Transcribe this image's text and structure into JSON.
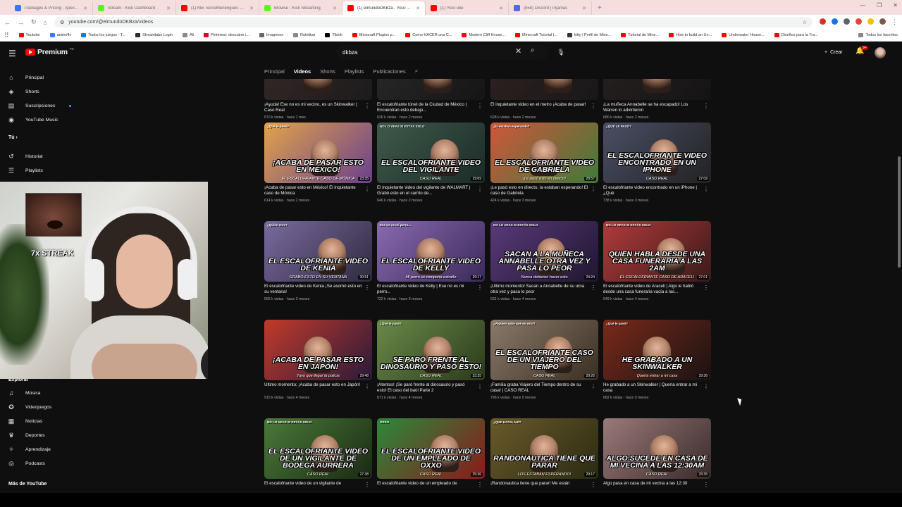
{
  "browser": {
    "tabs": [
      {
        "label": "Packages & Pricing - Apex Hosting",
        "color": "#3a78ff",
        "active": false
      },
      {
        "label": "Stream - Kick Dashboard",
        "color": "#53fc18",
        "active": false
      },
      {
        "label": "(1) Mix TecnoMenengues Clips",
        "color": "#ff0000",
        "active": false
      },
      {
        "label": "Browse - Kick Streaming",
        "color": "#53fc18",
        "active": false
      },
      {
        "label": "(1) elmundoDKBza - YouTube",
        "color": "#ff0000",
        "active": true
      },
      {
        "label": "(1) YouTube",
        "color": "#ff0000",
        "active": false
      },
      {
        "label": "(858) Discord | Pijamas",
        "color": "#5865f2",
        "active": false
      }
    ],
    "url": "youtube.com/@elmundoDKBza/videos",
    "bookmarks": [
      "Youtube",
      "animeflv",
      "Todos los juegos - T...",
      "Streamlabs Login",
      "Ali",
      "Pinterest: descubre i...",
      "Imagenes",
      "Ruletitas",
      "Tiktok",
      "Minecraft Plugins p...",
      "Como HACER una C...",
      "Modern Cliff House...",
      "Minecraft Tutorial |...",
      "kitty | Perfil de Mine...",
      "Tutorial de Mine...",
      "How to build an Un...",
      "Underwater House...",
      "Diseños para la Tra..."
    ],
    "bookmarks_right": "Todos los favoritos"
  },
  "youtube": {
    "logo": "Premium",
    "logo_cc": "PE",
    "search_value": "dkbza",
    "create_label": "Crear",
    "notif_count": "9+"
  },
  "sidebar": {
    "items_top": [
      {
        "label": "Principal",
        "icon": "home-icon",
        "glyph": "⌂"
      },
      {
        "label": "Shorts",
        "icon": "shorts-icon",
        "glyph": "◈"
      },
      {
        "label": "Suscripciones",
        "icon": "subscriptions-icon",
        "glyph": "▤"
      },
      {
        "label": "YouTube Music",
        "icon": "music-icon",
        "glyph": "◉"
      }
    ],
    "you_label": "Tú ›",
    "items_you": [
      {
        "label": "Historial",
        "icon": "history-icon",
        "glyph": "↺"
      },
      {
        "label": "Playlists",
        "icon": "playlists-icon",
        "glyph": "☰"
      },
      {
        "label": "Tus videos",
        "icon": "your-videos-icon",
        "glyph": "▶"
      }
    ],
    "explore_label": "Explorar",
    "items_explore": [
      {
        "label": "Música",
        "icon": "music-note-icon",
        "glyph": "♫"
      },
      {
        "label": "Videojuegos",
        "icon": "gaming-icon",
        "glyph": "✪"
      },
      {
        "label": "Noticias",
        "icon": "news-icon",
        "glyph": "▦"
      },
      {
        "label": "Deportes",
        "icon": "trophy-icon",
        "glyph": "♛"
      },
      {
        "label": "Aprendizaje",
        "icon": "learning-icon",
        "glyph": "✧"
      },
      {
        "label": "Podcasts",
        "icon": "podcast-icon",
        "glyph": "◎"
      }
    ],
    "more_label": "Más de YouTube"
  },
  "webcam": {
    "streak": "7x STREAK"
  },
  "channel_tabs": [
    "Principal",
    "Videos",
    "Shorts",
    "Playlists",
    "Publicaciones"
  ],
  "active_tab": "Videos",
  "videos": [
    {
      "title": "¡Ayuda! Ese no es mi vecino, es un Skinwalker | Caso Real",
      "meta": "570 k vistas · hace 1 mes",
      "big": "",
      "sub": "",
      "top": "",
      "dur": "",
      "bg": "#3a2a2a",
      "bg2": "#1b1b1b"
    },
    {
      "title": "El escalofriante túnel de la Ciudad de México | Encuentran esto debajo...",
      "meta": "626 k vistas · hace 2 meses",
      "big": "",
      "sub": "",
      "top": "",
      "dur": "",
      "bg": "#2b2b2b",
      "bg2": "#151515"
    },
    {
      "title": "El inquietante video en el metro ¡Acaba de pasar!",
      "meta": "628 k vistas · hace 2 meses",
      "big": "",
      "sub": "",
      "top": "",
      "dur": "",
      "bg": "#332222",
      "bg2": "#181818"
    },
    {
      "title": "¡La muñeca Annabelle se ha escapado! Los Warren lo advirtieron",
      "meta": "680 k vistas · hace 2 meses",
      "big": "",
      "sub": "",
      "top": "",
      "dur": "",
      "bg": "#2a2222",
      "bg2": "#141414"
    },
    {
      "title": "¡Acaba de pasar esto en México! El inquietante caso de Mónica",
      "meta": "614 k vistas · hace 2 meses",
      "big": "¡ACABA DE PASAR ESTO EN MÉXICO!",
      "sub": "EL ESCALOFRIANTE CASO DE MÓNICA",
      "top": "¿Qué le pasó?",
      "dur": "23:35",
      "bg": "#e2a34a",
      "bg2": "#6a3f8e"
    },
    {
      "title": "El inquietante video del vigilante de WALMART | Grabó esto en el carrito de...",
      "meta": "646 k vistas · hace 2 meses",
      "big": "EL ESCALOFRIANTE VIDEO DEL VIGILANTE",
      "sub": "CASO REAL",
      "top": "NO LO VEAS SI ESTÁS SOLO",
      "dur": "29:09",
      "bg": "#3f5a4a",
      "bg2": "#1a2b28"
    },
    {
      "title": "¡Le pasó esto en directo, la estaban esperando! El caso de Gabriela",
      "meta": "424 k vistas · hace 3 meses",
      "big": "EL ESCALOFRIANTE VIDEO DE GABRIELA",
      "sub": "¡Le pasó esto en directo!",
      "top": "¿la estaban esperando?",
      "dur": "28:57",
      "bg": "#d0563a",
      "bg2": "#3e7a3a"
    },
    {
      "title": "El escalofriante video encontrado en un iPhone | ¿Qué",
      "meta": "738 k vistas · hace 3 meses",
      "big": "EL ESCALOFRIANTE VIDEO ENCONTRADO EN UN IPHONE",
      "sub": "CASO REAL",
      "top": "¿QUÉ LE PASÓ?",
      "dur": "27:09",
      "bg": "#4a4f66",
      "bg2": "#222"
    },
    {
      "title": "El escalofriante video de Kenia ¡Se asomó esto en su ventana!",
      "meta": "566 k vistas · hace 3 meses",
      "big": "EL ESCALOFRIANTE VIDEO DE KENIA",
      "sub": "GRABÓ ESTO EN SU VENTANA",
      "top": "¿Quién eres?",
      "dur": "30:51",
      "bg": "#7a6aa0",
      "bg2": "#2f2a3f"
    },
    {
      "title": "El escalofriante video de Kelly | Ese no es mi perro...",
      "meta": "722 k vistas · hace 3 meses",
      "big": "EL ESCALOFRIANTE VIDEO DE KELLY",
      "sub": "Mi perro se comporta extraño",
      "top": "Ese no es mi perro...",
      "dur": "29:17",
      "bg": "#8a6ab0",
      "bg2": "#3a2a5a"
    },
    {
      "title": "¡Último momento! Sacan a Annabelle de su urna otra vez y pasa lo peor",
      "meta": "531 k vistas · hace 4 meses",
      "big": "SACAN A LA MUÑECA ANNABELLE OTRA VEZ Y PASA LO PEOR",
      "sub": "Nunca debieron hacer esto",
      "top": "NO LO VEAS SI ESTÁS SOLO",
      "dur": "24:24",
      "bg": "#5a3a7a",
      "bg2": "#1f1630"
    },
    {
      "title": "El escalofriante video de Araceli | Algo le habló desde una casa funeraria vacía a las...",
      "meta": "549 k vistas · hace 4 meses",
      "big": "QUIEN HABLA DESDE UNA CASA FUNERARIA A LAS 2AM",
      "sub": "EL ESCALOFRIANTE CASO DE ARACELI",
      "top": "NO LO VEAS SI ESTÁS SOLO",
      "dur": "27:01",
      "bg": "#b23a3a",
      "bg2": "#3a1a1a"
    },
    {
      "title": "Último momento: ¡Acaba de pasar esto en Japón!",
      "meta": "915 k vistas · hace 4 meses",
      "big": "¡ACABA DE PASAR ESTO EN JAPÓN!",
      "sub": "Tuvo que llegar la policía",
      "top": "",
      "dur": "29:48",
      "bg": "#c23a2a",
      "bg2": "#2a1a3a"
    },
    {
      "title": "¡Atentos! ¡Se paró frente al dinosaurio y pasó esto! El caso del baúl Parte 2",
      "meta": "671 k vistas · hace 4 meses",
      "big": "SE PARÓ FRENTE AL DINOSAURIO Y PASÓ ESTO!",
      "sub": "CASO REAL",
      "top": "¿Qué le pasó?",
      "dur": "33:25",
      "bg": "#6a8a4a",
      "bg2": "#2a3a1a"
    },
    {
      "title": "¡Familia graba Viajero del Tiempo dentro de su casa! | CASO REAL",
      "meta": "796 k vistas · hace 5 meses",
      "big": "EL ESCALOFRIANTE CASO DE UN VIAJERO DEL TIEMPO",
      "sub": "CASO REAL",
      "top": "¿Alguien sabe qué es esto?",
      "dur": "29:26",
      "bg": "#8a7a6a",
      "bg2": "#3a2e22"
    },
    {
      "title": "He grabado a un Skinwalker | Quería entrar a mi casa",
      "meta": "682 k vistas · hace 5 meses",
      "big": "HE GRABADO A UN SKINWALKER",
      "sub": "Quería entrar a mi casa",
      "top": "¿Qué le pasó?",
      "dur": "29:36",
      "bg": "#7a2a1a",
      "bg2": "#1a1212"
    },
    {
      "title": "El escalofriante video de un vigilante de",
      "meta": "",
      "big": "EL ESCALOFRIANTE VIDEO DE UN VIGILANTE DE BODEGA AURRERA",
      "sub": "CASO REAL",
      "top": "NO LO VEAS SI ESTÁS SOLO",
      "dur": "27:38",
      "bg": "#4a7a3a",
      "bg2": "#1a2a12"
    },
    {
      "title": "El escalofriante video de un empleado de",
      "meta": "",
      "big": "EL ESCALOFRIANTE VIDEO DE UN EMPLEADO DE OXXO",
      "sub": "CASO REAL",
      "top": "OXXO",
      "dur": "25:36",
      "bg": "#2a8a3a",
      "bg2": "#8a1a1a"
    },
    {
      "title": "¡Randonautica tiene que parar! Me están",
      "meta": "",
      "big": "RANDONAUTICA TIENE QUE PARAR",
      "sub": "LOS ESTABAN ESPERANDO!",
      "top": "¿QUE HACIA AHÍ?",
      "dur": "29:17",
      "bg": "#6a5a2a",
      "bg2": "#2a2a12"
    },
    {
      "title": "Algo pasa en casa de mi vecina a las 12:30",
      "meta": "",
      "big": "ALGO SUCEDE EN CASA DE MI VECINA A LAS 12:30AM",
      "sub": "CASO REAL",
      "top": "",
      "dur": "33:35",
      "bg": "#9a7a7a",
      "bg2": "#3a2a2a"
    }
  ]
}
